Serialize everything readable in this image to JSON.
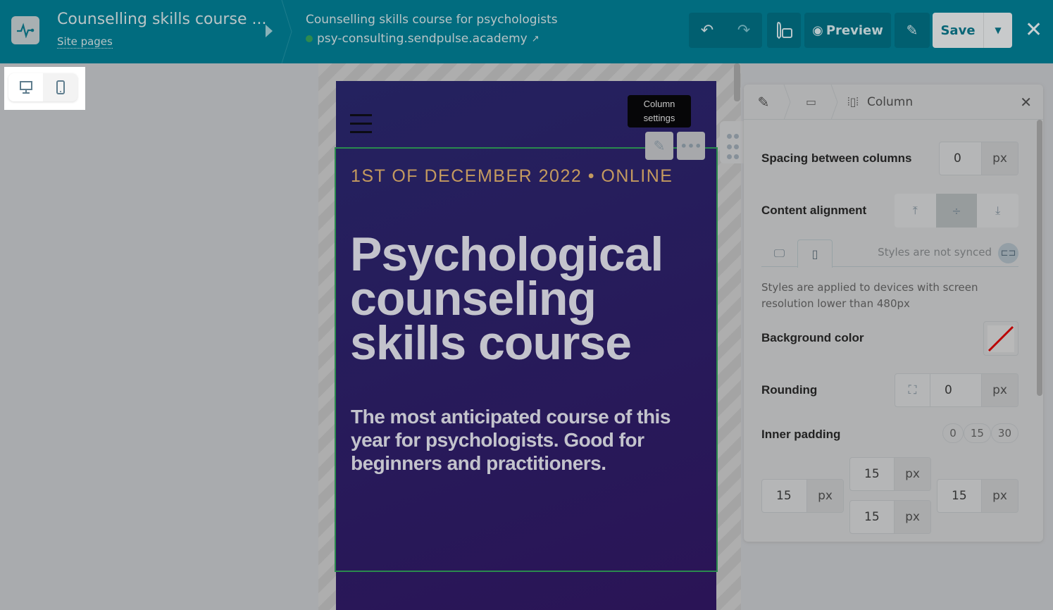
{
  "header": {
    "site_title": "Counselling skills course ...",
    "site_pages_link": "Site pages",
    "page_title": "Counselling skills course for psychologists",
    "page_url": "psy-consulting.sendpulse.academy",
    "preview_label": "Preview",
    "save_label": "Save"
  },
  "canvas": {
    "date_line": "1ST OF DECEMBER 2022 • ONLINE",
    "headline": "Psychological counseling skills course",
    "subtitle": "The most anticipated course of this year for psychologists. Good for beginners and practitioners.",
    "tooltip": "Column settings"
  },
  "panel": {
    "breadcrumb_current": "Column",
    "spacing_label": "Spacing between columns",
    "spacing_value": "0",
    "unit": "px",
    "alignment_label": "Content alignment",
    "sync_status": "Styles are not synced",
    "device_note": "Styles are applied to devices with screen resolution lower than 480px",
    "bg_color_label": "Background color",
    "rounding_label": "Rounding",
    "rounding_value": "0",
    "padding_label": "Inner padding",
    "padding_presets": [
      "0",
      "15",
      "30"
    ],
    "padding": {
      "top": "15",
      "bottom": "15",
      "left": "15",
      "right": "15"
    }
  },
  "colors": {
    "header": "#016c7f",
    "accent_green": "#2a8a4e",
    "date": "#c49a5f"
  }
}
